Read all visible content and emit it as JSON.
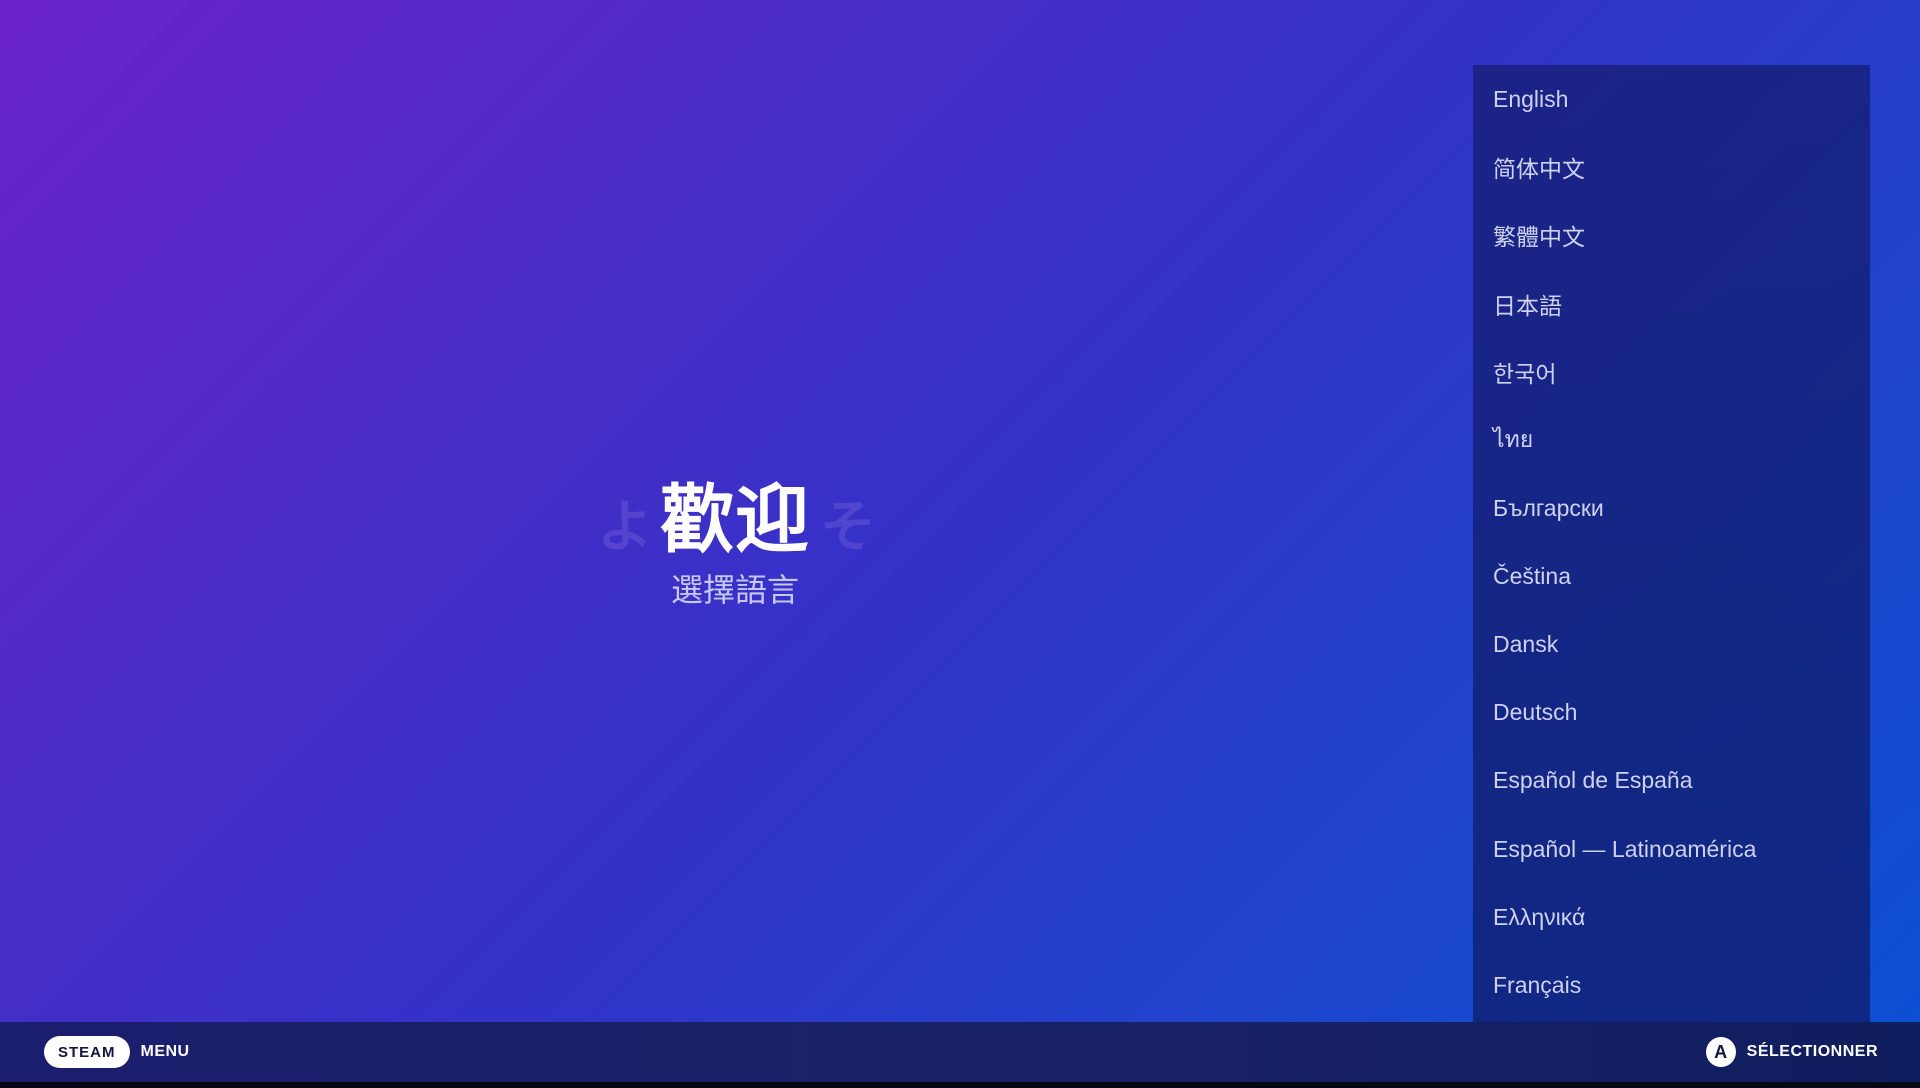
{
  "welcome": {
    "title": "歡迎",
    "subtitle": "選擇語言",
    "ghost_left": "よ",
    "ghost_right": "そ"
  },
  "languages": [
    "English",
    "简体中文",
    "繁體中文",
    "日本語",
    "한국어",
    "ไทย",
    "Български",
    "Čeština",
    "Dansk",
    "Deutsch",
    "Español de España",
    "Español — Latinoamérica",
    "Ελληνικά",
    "Français"
  ],
  "bottom_bar": {
    "steam_label": "STEAM",
    "menu_label": "MENU",
    "a_button": "A",
    "select_label": "SÉLECTIONNER"
  },
  "colors": {
    "background_start": "#6a22c8",
    "background_end": "#0a50d4",
    "panel": "#141c6e",
    "text_light": "#cdd2ee"
  }
}
